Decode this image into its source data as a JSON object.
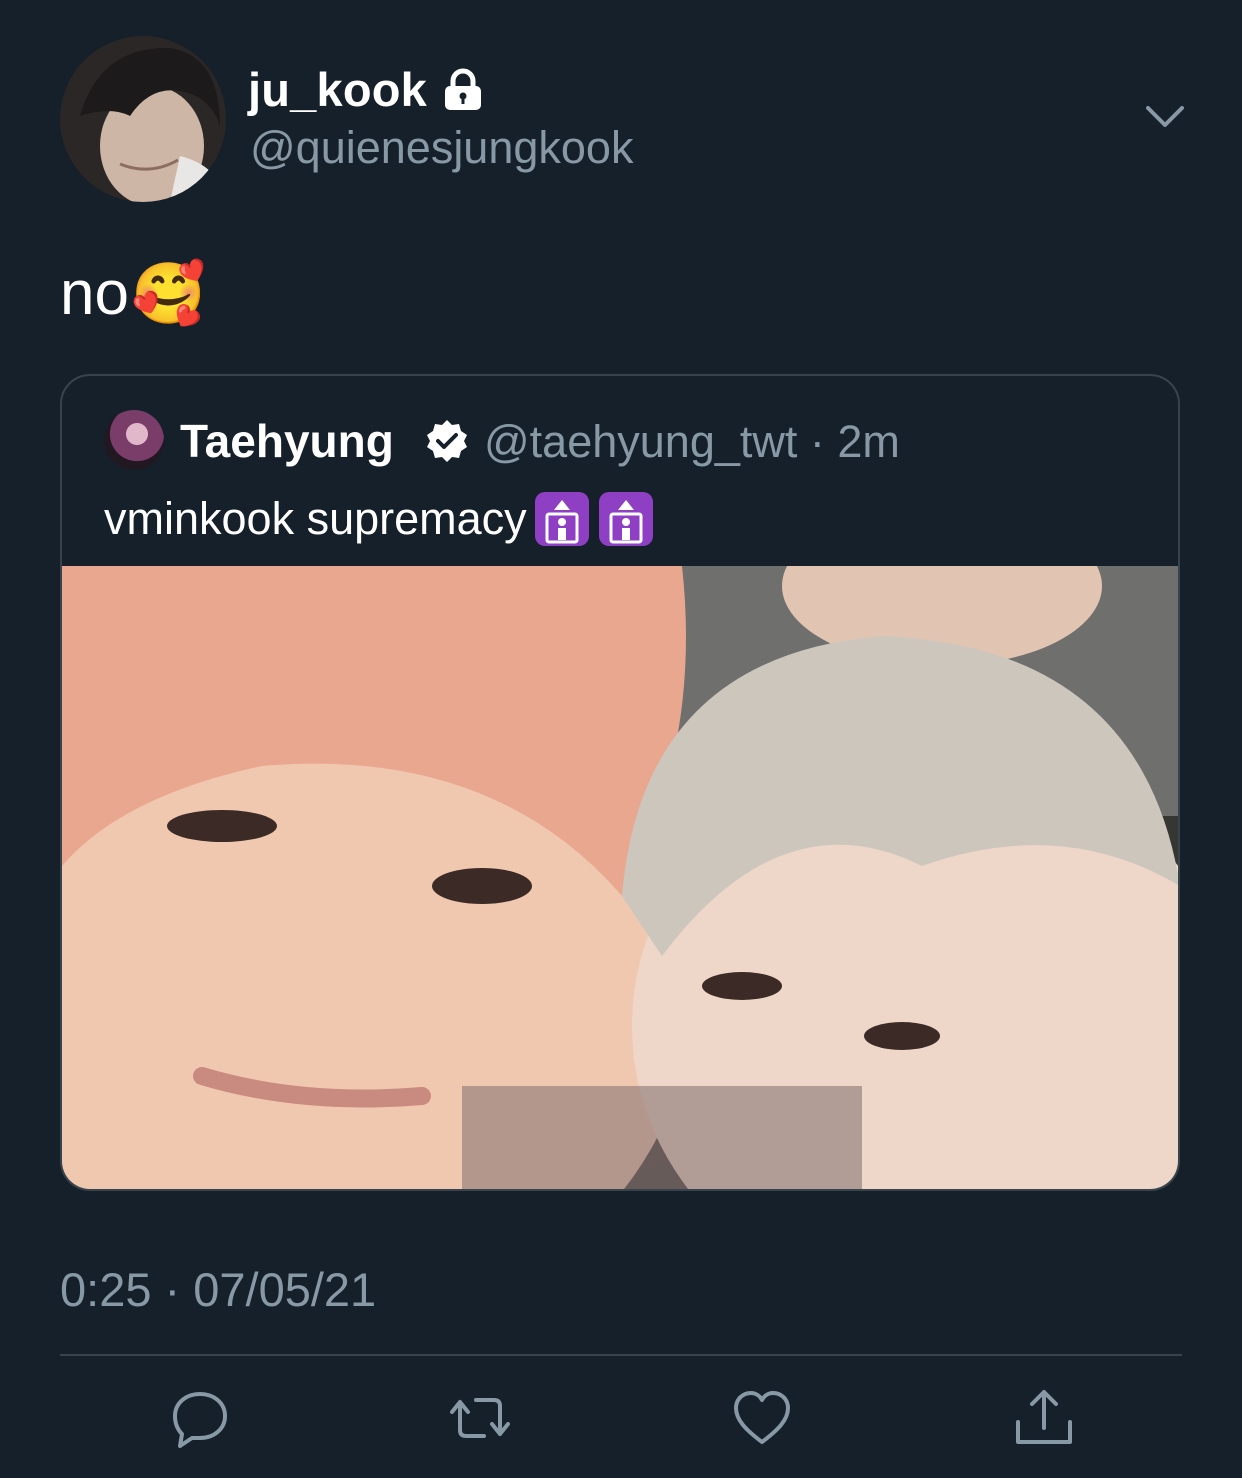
{
  "author": {
    "display_name": "ju_kook",
    "handle": "@quienesjungkook",
    "protected_icon": "lock-icon"
  },
  "tweet": {
    "text": "no",
    "emoji": "🥰",
    "timestamp": "0:25 · 07/05/21"
  },
  "quoted_tweet": {
    "display_name": "Taehyung",
    "verified_icon": "verified-badge-icon",
    "handle_time": "@taehyung_twt · 2m",
    "text": "vminkook supremacy",
    "emoji_icons": [
      "elevator-icon",
      "elevator-icon"
    ]
  },
  "actions": [
    "reply-icon",
    "retweet-icon",
    "like-icon",
    "share-icon"
  ],
  "colors": {
    "background": "#15202b",
    "secondary_text": "#8899a6",
    "border": "#38444d",
    "primary_text": "#ffffff"
  }
}
